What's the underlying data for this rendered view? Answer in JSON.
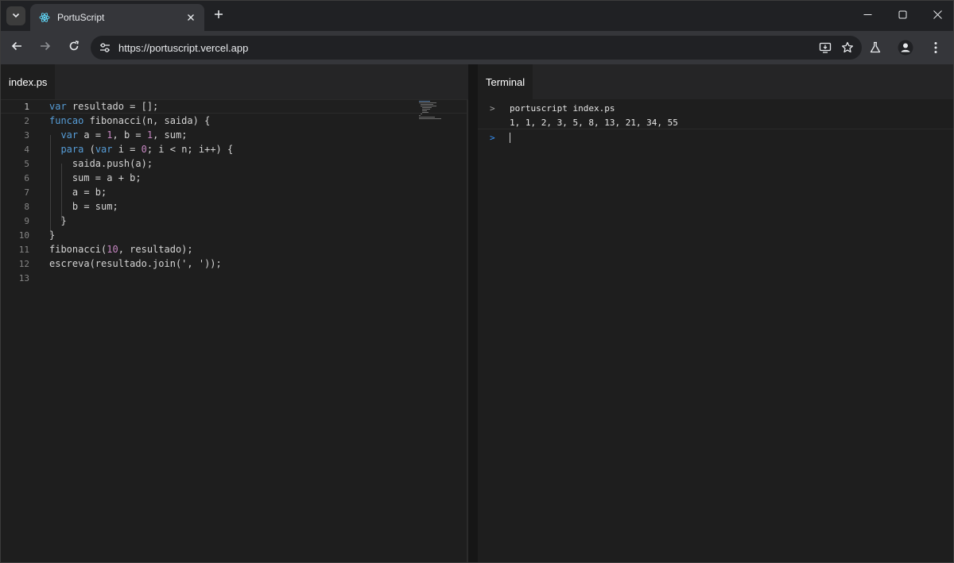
{
  "browser": {
    "tab_title": "PortuScript",
    "url": "https://portuscript.vercel.app",
    "icons": {
      "tab_search": "chevron-down-icon",
      "favicon": "react-atom-icon",
      "tab_close": "close-icon",
      "new_tab": "plus-icon",
      "minimize": "minimize-icon",
      "maximize": "maximize-icon",
      "close_window": "close-icon",
      "back": "arrow-left-icon",
      "forward": "arrow-right-icon",
      "reload": "reload-icon",
      "site_info": "tune-icon",
      "install_app": "install-icon",
      "bookmark": "star-icon",
      "labs": "flask-icon",
      "profile": "person-icon",
      "menu": "kebab-menu-icon"
    }
  },
  "editor": {
    "file_tab": "index.ps",
    "current_line": 1,
    "line_numbers": [
      "1",
      "2",
      "3",
      "4",
      "5",
      "6",
      "7",
      "8",
      "9",
      "10",
      "11",
      "12",
      "13"
    ],
    "lines": [
      [
        {
          "t": "var",
          "c": "kw"
        },
        {
          "t": " resultado = [];",
          "c": "plain"
        }
      ],
      [
        {
          "t": "funcao",
          "c": "kw"
        },
        {
          "t": " fibonacci(n, saida) {",
          "c": "plain"
        }
      ],
      [
        {
          "t": "  ",
          "c": "plain"
        },
        {
          "t": "var",
          "c": "kw"
        },
        {
          "t": " a = ",
          "c": "plain"
        },
        {
          "t": "1",
          "c": "num"
        },
        {
          "t": ", b = ",
          "c": "plain"
        },
        {
          "t": "1",
          "c": "num"
        },
        {
          "t": ", sum;",
          "c": "plain"
        }
      ],
      [
        {
          "t": "  ",
          "c": "plain"
        },
        {
          "t": "para",
          "c": "kw"
        },
        {
          "t": " (",
          "c": "plain"
        },
        {
          "t": "var",
          "c": "kw"
        },
        {
          "t": " i = ",
          "c": "plain"
        },
        {
          "t": "0",
          "c": "num"
        },
        {
          "t": "; i < n; i++) {",
          "c": "plain"
        }
      ],
      [
        {
          "t": "    saida.push(a);",
          "c": "plain"
        }
      ],
      [
        {
          "t": "    sum = a + b;",
          "c": "plain"
        }
      ],
      [
        {
          "t": "    a = b;",
          "c": "plain"
        }
      ],
      [
        {
          "t": "    b = sum;",
          "c": "plain"
        }
      ],
      [
        {
          "t": "  }",
          "c": "plain"
        }
      ],
      [
        {
          "t": "}",
          "c": "plain"
        }
      ],
      [
        {
          "t": "fibonacci(",
          "c": "plain"
        },
        {
          "t": "10",
          "c": "num"
        },
        {
          "t": ", resultado);",
          "c": "plain"
        }
      ],
      [
        {
          "t": "escreva(resultado.join(', '));",
          "c": "plain"
        }
      ],
      []
    ]
  },
  "terminal": {
    "tab": "Terminal",
    "prompt_symbol": ">",
    "command": "portuscript index.ps",
    "output": "1, 1, 2, 3, 5, 8, 13, 21, 34, 55"
  },
  "colors": {
    "keyword": "#569cd6",
    "number": "#c586c0",
    "prompt_past": "#a0a0a0",
    "prompt_active": "#3794ff"
  }
}
